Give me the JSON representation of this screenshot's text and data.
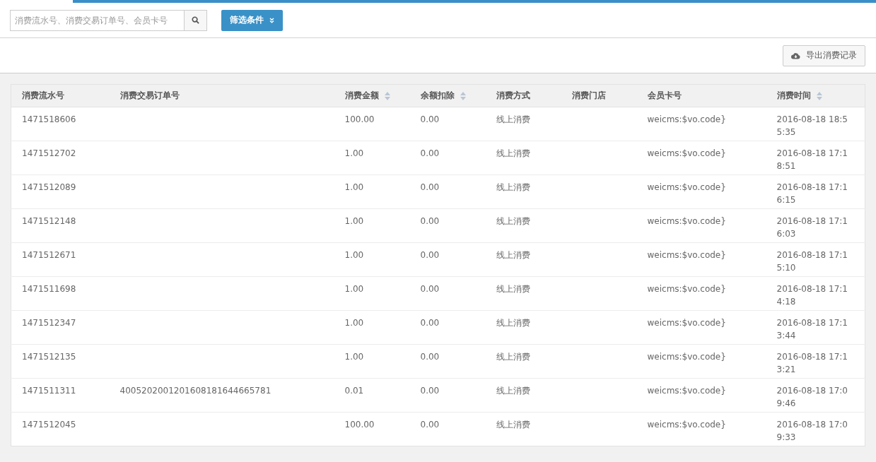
{
  "search": {
    "placeholder": "消费流水号、消费交易订单号、会员卡号"
  },
  "filter_button": {
    "label": "筛选条件"
  },
  "export_button": {
    "label": "导出消费记录"
  },
  "table": {
    "columns": [
      {
        "label": "消费流水号",
        "sortable": false
      },
      {
        "label": "消费交易订单号",
        "sortable": false
      },
      {
        "label": "消费金额",
        "sortable": true
      },
      {
        "label": "余额扣除",
        "sortable": true
      },
      {
        "label": "消费方式",
        "sortable": false
      },
      {
        "label": "消费门店",
        "sortable": false
      },
      {
        "label": "会员卡号",
        "sortable": false
      },
      {
        "label": "消费时间",
        "sortable": true
      }
    ],
    "rows": [
      [
        "1471518606",
        "",
        "100.00",
        "0.00",
        "线上消费",
        "",
        "weicms:$vo.code}",
        "2016-08-18 18:55:35"
      ],
      [
        "1471512702",
        "",
        "1.00",
        "0.00",
        "线上消费",
        "",
        "weicms:$vo.code}",
        "2016-08-18 17:18:51"
      ],
      [
        "1471512089",
        "",
        "1.00",
        "0.00",
        "线上消费",
        "",
        "weicms:$vo.code}",
        "2016-08-18 17:16:15"
      ],
      [
        "1471512148",
        "",
        "1.00",
        "0.00",
        "线上消费",
        "",
        "weicms:$vo.code}",
        "2016-08-18 17:16:03"
      ],
      [
        "1471512671",
        "",
        "1.00",
        "0.00",
        "线上消费",
        "",
        "weicms:$vo.code}",
        "2016-08-18 17:15:10"
      ],
      [
        "1471511698",
        "",
        "1.00",
        "0.00",
        "线上消费",
        "",
        "weicms:$vo.code}",
        "2016-08-18 17:14:18"
      ],
      [
        "1471512347",
        "",
        "1.00",
        "0.00",
        "线上消费",
        "",
        "weicms:$vo.code}",
        "2016-08-18 17:13:44"
      ],
      [
        "1471512135",
        "",
        "1.00",
        "0.00",
        "线上消费",
        "",
        "weicms:$vo.code}",
        "2016-08-18 17:13:21"
      ],
      [
        "1471511311",
        "4005202001201608181644665781",
        "0.01",
        "0.00",
        "线上消费",
        "",
        "weicms:$vo.code}",
        "2016-08-18 17:09:46"
      ],
      [
        "1471512045",
        "",
        "100.00",
        "0.00",
        "线上消费",
        "",
        "weicms:$vo.code}",
        "2016-08-18 17:09:33"
      ]
    ]
  }
}
